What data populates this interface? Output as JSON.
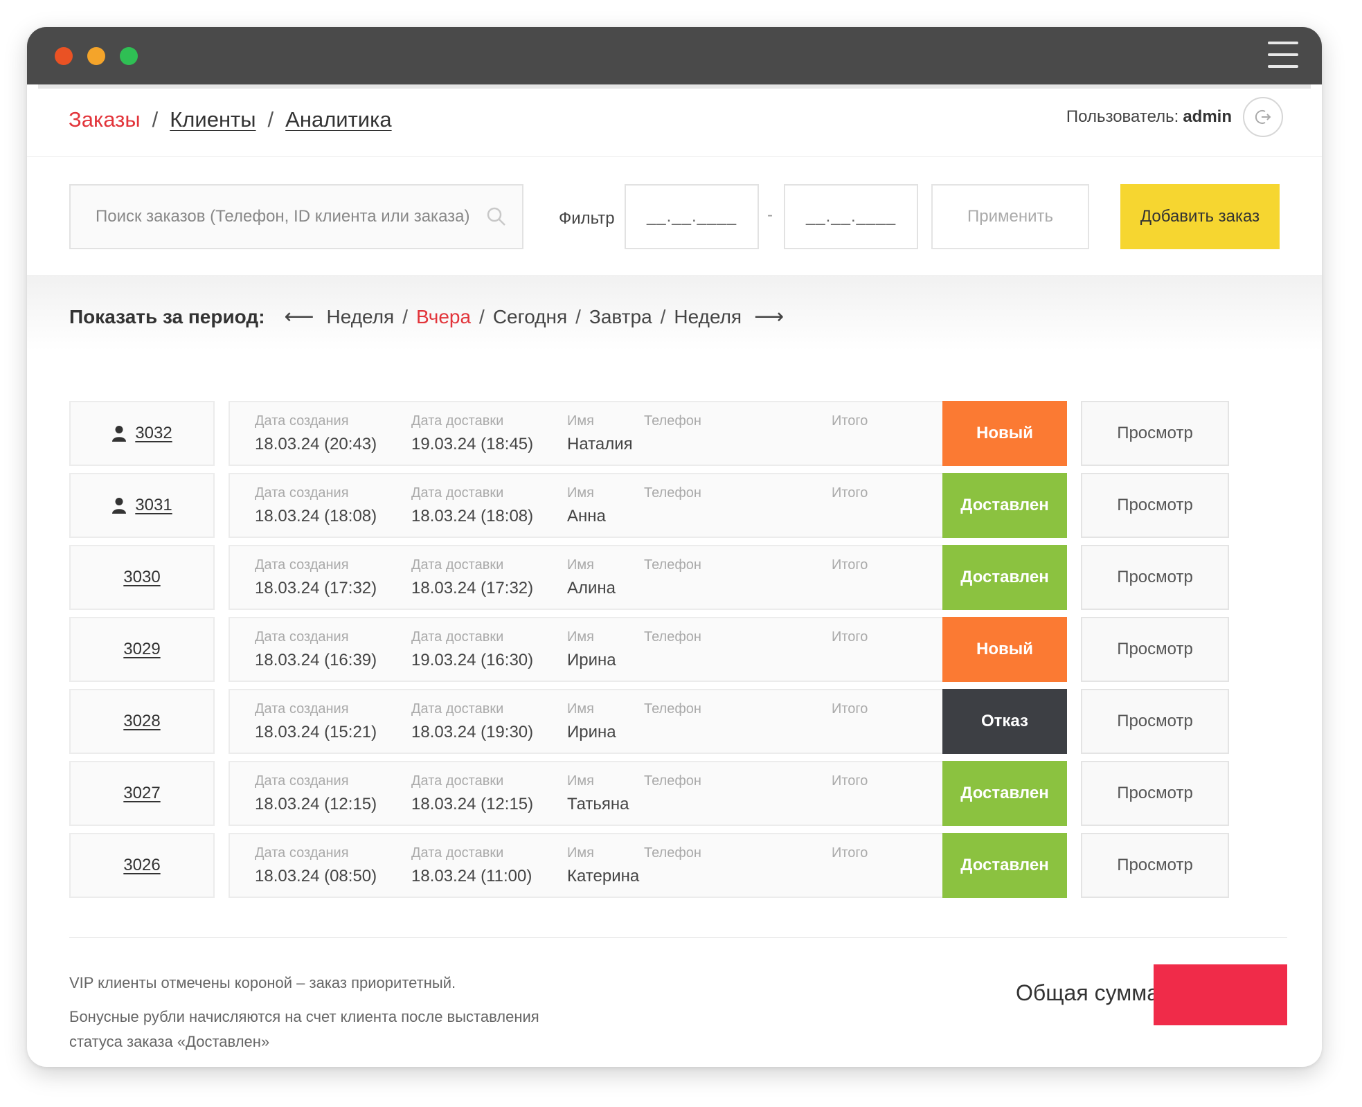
{
  "nav": {
    "items": [
      {
        "label": "Заказы",
        "active": true
      },
      {
        "label": "Клиенты",
        "active": false
      },
      {
        "label": "Аналитика",
        "active": false
      }
    ],
    "separator": "/"
  },
  "user": {
    "prefix": "Пользователь:",
    "name": "admin"
  },
  "search": {
    "placeholder": "Поиск заказов (Телефон, ID клиента или заказа)"
  },
  "filter": {
    "label": "Фильтр",
    "from_placeholder": "__.__.____",
    "to_placeholder": "__.__.____",
    "dash": "-",
    "apply_label": "Применить"
  },
  "add_order_label": "Добавить заказ",
  "period": {
    "label": "Показать за период:",
    "prev_arrow": "⟵",
    "next_arrow": "⟶",
    "separator": "/",
    "options": [
      {
        "label": "Неделя",
        "active": false
      },
      {
        "label": "Вчера",
        "active": true
      },
      {
        "label": "Сегодня",
        "active": false
      },
      {
        "label": "Завтра",
        "active": false
      },
      {
        "label": "Неделя",
        "active": false
      }
    ]
  },
  "columns": {
    "created": "Дата создания",
    "delivery": "Дата доставки",
    "name": "Имя",
    "phone": "Телефон",
    "total": "Итого"
  },
  "view_label": "Просмотр",
  "status_colors": {
    "Новый": "#fb7a33",
    "Доставлен": "#8bc240",
    "Отказ": "#3d3f44"
  },
  "orders": [
    {
      "id": "3032",
      "vip": true,
      "created": "18.03.24 (20:43)",
      "delivery": "19.03.24 (18:45)",
      "name": "Наталия",
      "phone": "",
      "total": "",
      "status": "Новый"
    },
    {
      "id": "3031",
      "vip": true,
      "created": "18.03.24 (18:08)",
      "delivery": "18.03.24 (18:08)",
      "name": "Анна",
      "phone": "",
      "total": "",
      "status": "Доставлен"
    },
    {
      "id": "3030",
      "vip": false,
      "created": "18.03.24 (17:32)",
      "delivery": "18.03.24 (17:32)",
      "name": "Алина",
      "phone": "",
      "total": "",
      "status": "Доставлен"
    },
    {
      "id": "3029",
      "vip": false,
      "created": "18.03.24 (16:39)",
      "delivery": "19.03.24 (16:30)",
      "name": "Ирина",
      "phone": "",
      "total": "",
      "status": "Новый"
    },
    {
      "id": "3028",
      "vip": false,
      "created": "18.03.24 (15:21)",
      "delivery": "18.03.24 (19:30)",
      "name": "Ирина",
      "phone": "",
      "total": "",
      "status": "Отказ"
    },
    {
      "id": "3027",
      "vip": false,
      "created": "18.03.24 (12:15)",
      "delivery": "18.03.24 (12:15)",
      "name": "Татьяна",
      "phone": "",
      "total": "",
      "status": "Доставлен"
    },
    {
      "id": "3026",
      "vip": false,
      "created": "18.03.24 (08:50)",
      "delivery": "18.03.24 (11:00)",
      "name": "Катерина",
      "phone": "",
      "total": "",
      "status": "Доставлен"
    }
  ],
  "footer": {
    "note_vip": "VIP клиенты отмечены короной – заказ приоритетный.",
    "note_bonus": "Бонусные рубли начисляются на счет клиента после выставления статуса заказа «Доставлен»",
    "total_label": "Общая сумма",
    "total_value": "",
    "total_color": "#f02b49"
  }
}
